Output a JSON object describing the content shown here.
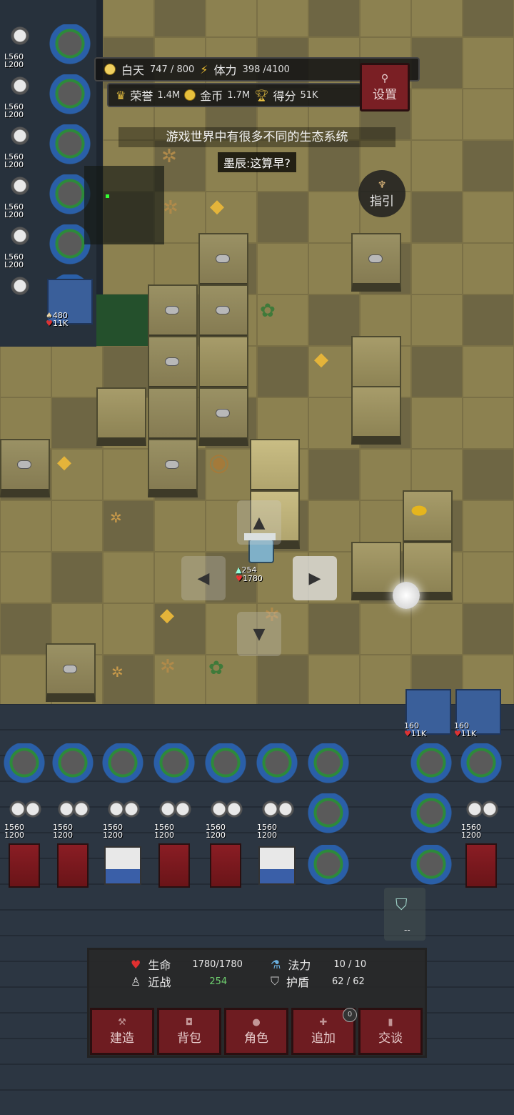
{
  "hud": {
    "day_label": "白天",
    "day_value": "747 / 800",
    "stamina_label": "体力",
    "stamina_value": "398 /4100",
    "honor_label": "荣誉",
    "honor_value": "1.4M",
    "gold_label": "金币",
    "gold_value": "1.7M",
    "score_label": "得分",
    "score_value": "51K",
    "settings_label": "设置"
  },
  "message": "游戏世界中有很多不同的生态系统",
  "speech": "墨辰:这算早?",
  "guide_label": "指引",
  "hero": {
    "attack": "254",
    "hp": "1780"
  },
  "tower_labels": {
    "l560": "L560",
    "l200": "L200",
    "gate_atk": "480",
    "gate_hp": "11K",
    "gate2_atk": "160",
    "gate2_hp": "11K",
    "t1560": "1560",
    "t1200": "1200"
  },
  "side_slot_value": "--",
  "status": {
    "life_label": "生命",
    "life_value": "1780/1780",
    "mana_label": "法力",
    "mana_value": "10 / 10",
    "melee_label": "近战",
    "melee_value": "254",
    "shield_label": "护盾",
    "shield_value": "62 / 62"
  },
  "menu": [
    {
      "label": "建造",
      "icon": "hammer-icon"
    },
    {
      "label": "背包",
      "icon": "bag-icon"
    },
    {
      "label": "角色",
      "icon": "person-icon"
    },
    {
      "label": "追加",
      "icon": "plus-icon"
    },
    {
      "label": "交谈",
      "icon": "chat-icon"
    }
  ],
  "add_badge": "0",
  "colors": {
    "sand": "#8c8150",
    "stone": "#2a3440",
    "button_red": "#6e1c21",
    "panel": "#282828"
  }
}
